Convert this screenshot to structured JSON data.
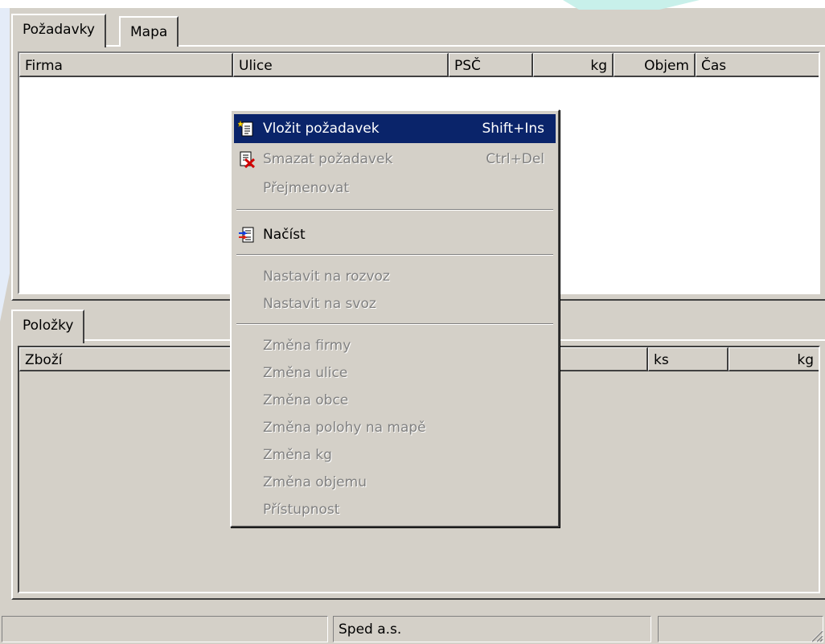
{
  "tabs": [
    {
      "label": "Požadavky",
      "active": true
    },
    {
      "label": "Mapa",
      "active": false
    }
  ],
  "requests_grid": {
    "columns": [
      "Firma",
      "Ulice",
      "PSČ",
      "kg",
      "Objem",
      "Čas"
    ]
  },
  "lower_tabs": [
    {
      "label": "Položky",
      "active": true
    }
  ],
  "items_grid": {
    "columns": [
      "Zboží",
      "ks",
      "kg"
    ]
  },
  "context_menu": {
    "items": [
      {
        "label": "Vložit požadavek",
        "shortcut": "Shift+Ins",
        "icon": "insert-document-icon",
        "state": "highlighted"
      },
      {
        "label": "Smazat požadavek",
        "shortcut": "Ctrl+Del",
        "icon": "delete-document-icon",
        "state": "disabled"
      },
      {
        "label": "Přejmenovat",
        "state": "disabled"
      },
      {
        "label": "Načíst",
        "icon": "load-document-icon",
        "state": "enabled"
      },
      {
        "label": "Nastavit na rozvoz",
        "state": "disabled"
      },
      {
        "label": "Nastavit na svoz",
        "state": "disabled"
      },
      {
        "label": "Změna firmy",
        "state": "disabled"
      },
      {
        "label": "Změna ulice",
        "state": "disabled"
      },
      {
        "label": "Změna obce",
        "state": "disabled"
      },
      {
        "label": "Změna polohy na mapě",
        "state": "disabled"
      },
      {
        "label": "Změna kg",
        "state": "disabled"
      },
      {
        "label": "Změna objemu",
        "state": "disabled"
      },
      {
        "label": "Přístupnost",
        "state": "disabled"
      }
    ]
  },
  "statusbar": {
    "panels": [
      "",
      "Sped a.s.",
      ""
    ]
  },
  "colors": {
    "face": "#d4d0c8",
    "highlight": "#0a246a",
    "accent_decor": "#c8f0ea"
  }
}
